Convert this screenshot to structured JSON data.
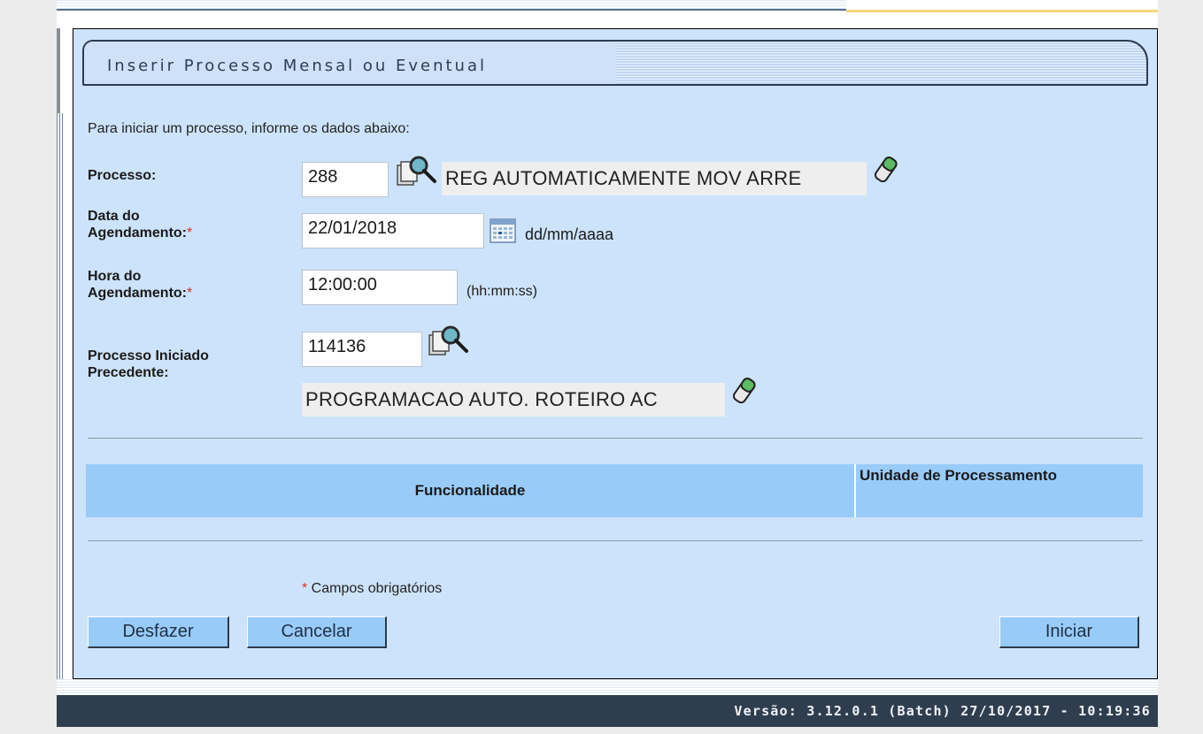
{
  "panel": {
    "title": "Inserir Processo Mensal ou Eventual",
    "instruction": "Para iniciar um processo, informe os dados abaixo:"
  },
  "form": {
    "processo": {
      "label": "Processo:",
      "value": "288",
      "description": "REG AUTOMATICAMENTE MOV ARRE"
    },
    "data_agendamento": {
      "label_line1": "Data do",
      "label_line2": "Agendamento:",
      "required_mark": "*",
      "value": "22/01/2018",
      "format_hint": "dd/mm/aaaa"
    },
    "hora_agendamento": {
      "label_line1": "Hora do",
      "label_line2": "Agendamento:",
      "required_mark": "*",
      "value": "12:00:00",
      "format_hint": "(hh:mm:ss)"
    },
    "processo_precedente": {
      "label_line1": "Processo Iniciado",
      "label_line2": "Precedente:",
      "value": "114136",
      "description": "PROGRAMACAO AUTO. ROTEIRO AC"
    }
  },
  "grid": {
    "columns": [
      "Funcionalidade",
      "Unidade de Processamento"
    ]
  },
  "required_note": {
    "mark": "*",
    "text": " Campos obrigatórios"
  },
  "buttons": {
    "undo": "Desfazer",
    "cancel": "Cancelar",
    "start": "Iniciar"
  },
  "footer": {
    "version": "Versão: 3.12.0.1 (Batch) 27/10/2017 - 10:19:36"
  },
  "colors": {
    "panel_bg": "#cde3fb",
    "header_bg": "#99cbf9",
    "button_bg": "#99cbf9",
    "footer_bg": "#2f3e4f",
    "required": "#e0302a"
  },
  "icons": [
    "search-icon",
    "eraser-icon",
    "calendar-icon"
  ]
}
